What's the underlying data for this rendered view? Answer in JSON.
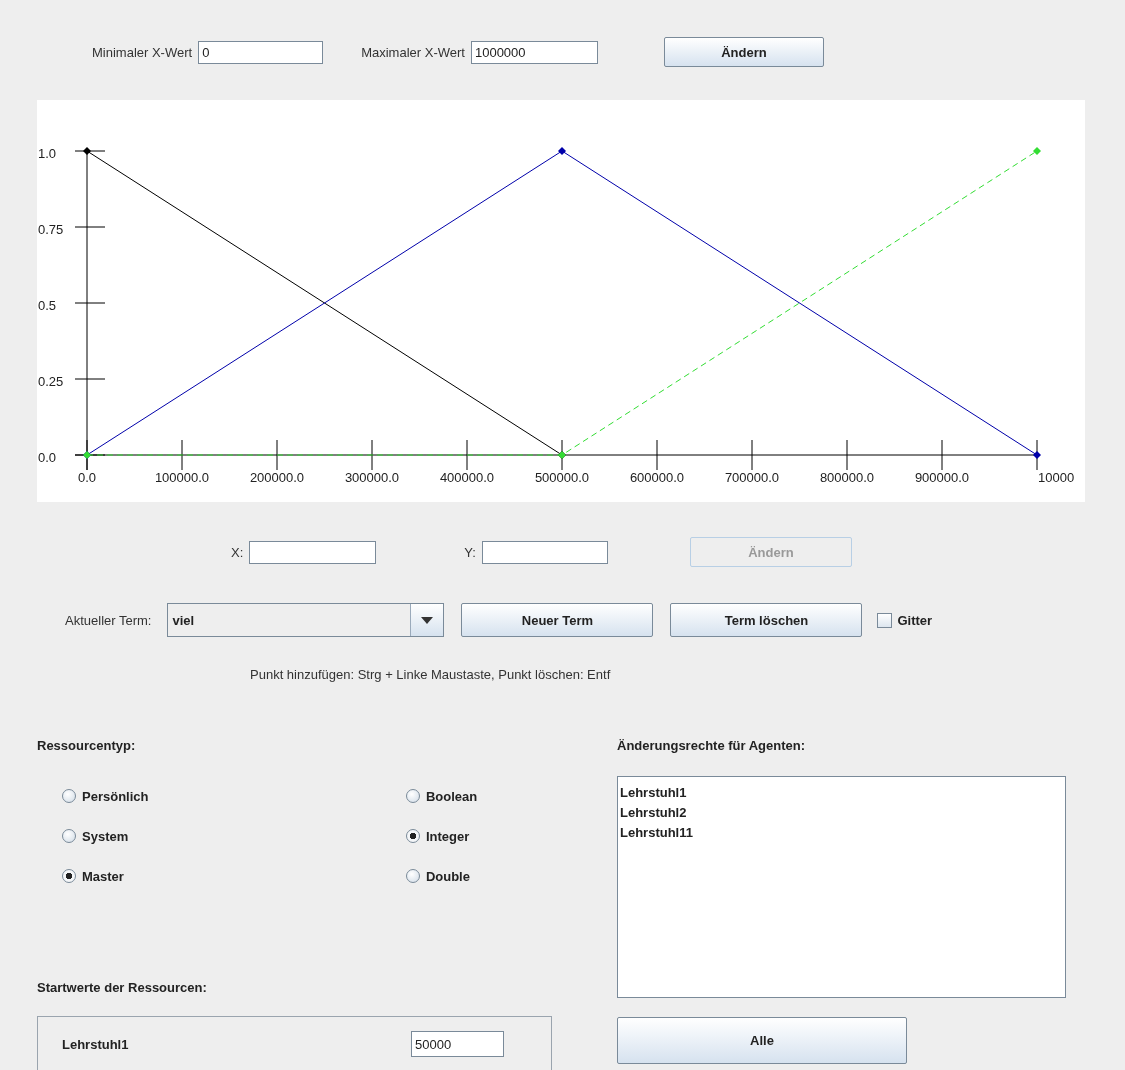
{
  "x_range": {
    "min_label": "Minimaler X-Wert",
    "min_value": "0",
    "max_label": "Maximaler X-Wert",
    "max_value": "1000000",
    "button": "Ändern"
  },
  "chart_data": {
    "type": "line",
    "x": [
      0,
      500000,
      1000000
    ],
    "series": [
      {
        "color": "#000000",
        "marker": "diamond",
        "line_style": "solid",
        "values": [
          1,
          0,
          null
        ]
      },
      {
        "color": "#0000aa",
        "marker": "diamond",
        "line_style": "solid",
        "values": [
          0,
          1,
          0
        ]
      },
      {
        "color": "#33dd33",
        "marker": "diamond",
        "line_style": "dashed",
        "values": [
          0,
          0,
          1
        ]
      }
    ],
    "xlim": [
      0,
      1000000
    ],
    "ylim": [
      0,
      1
    ],
    "xticks": [
      {
        "value": 0,
        "label": "0.0"
      },
      {
        "value": 100000,
        "label": "100000.0"
      },
      {
        "value": 200000,
        "label": "200000.0"
      },
      {
        "value": 300000,
        "label": "300000.0"
      },
      {
        "value": 400000,
        "label": "400000.0"
      },
      {
        "value": 500000,
        "label": "500000.0"
      },
      {
        "value": 600000,
        "label": "600000.0"
      },
      {
        "value": 700000,
        "label": "700000.0"
      },
      {
        "value": 800000,
        "label": "800000.0"
      },
      {
        "value": 900000,
        "label": "900000.0"
      }
    ],
    "yticks": [
      {
        "value": 0,
        "label": "0.0"
      },
      {
        "value": 0.25,
        "label": "0.25"
      },
      {
        "value": 0.5,
        "label": "0.5"
      },
      {
        "value": 0.75,
        "label": "0.75"
      },
      {
        "value": 1,
        "label": "1.0"
      }
    ]
  },
  "chart_cut_tick_label": "10000",
  "point_editor": {
    "x_label": "X:",
    "y_label": "Y:",
    "button": {
      "label": "Ändern",
      "disabled": true
    }
  },
  "term": {
    "label": "Aktueller Term:",
    "value": "viel",
    "new_button": "Neuer Term",
    "delete_button": "Term löschen",
    "grid_checkbox": {
      "label": "Gitter",
      "checked": false
    }
  },
  "hint": "Punkt hinzufügen: Strg + Linke Maustaste, Punkt löschen: Entf",
  "resource_type": {
    "title": "Ressourcentyp:",
    "groups": [
      [
        {
          "label": "Persönlich",
          "selected": false
        },
        {
          "label": "System",
          "selected": false
        },
        {
          "label": "Master",
          "selected": true
        }
      ],
      [
        {
          "label": "Boolean",
          "selected": false
        },
        {
          "label": "Integer",
          "selected": true
        },
        {
          "label": "Double",
          "selected": false
        }
      ]
    ]
  },
  "permissions": {
    "title": "Änderungsrechte für Agenten:",
    "items": [
      "Lehrstuhl1",
      "Lehrstuhl2",
      "Lehrstuhl11"
    ],
    "button": "Alle"
  },
  "start_values": {
    "title": "Startwerte der Ressourcen:",
    "rows": [
      {
        "name": "Lehrstuhl1",
        "value": "50000"
      }
    ]
  }
}
